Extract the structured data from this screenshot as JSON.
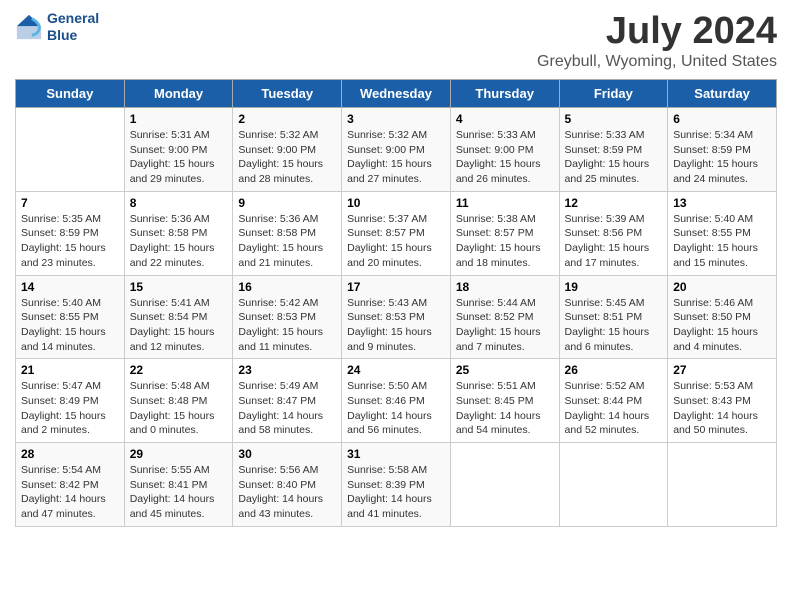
{
  "header": {
    "logo_line1": "General",
    "logo_line2": "Blue",
    "title": "July 2024",
    "subtitle": "Greybull, Wyoming, United States"
  },
  "days_of_week": [
    "Sunday",
    "Monday",
    "Tuesday",
    "Wednesday",
    "Thursday",
    "Friday",
    "Saturday"
  ],
  "weeks": [
    [
      {
        "num": "",
        "sunrise": "",
        "sunset": "",
        "daylight": ""
      },
      {
        "num": "1",
        "sunrise": "Sunrise: 5:31 AM",
        "sunset": "Sunset: 9:00 PM",
        "daylight": "Daylight: 15 hours and 29 minutes."
      },
      {
        "num": "2",
        "sunrise": "Sunrise: 5:32 AM",
        "sunset": "Sunset: 9:00 PM",
        "daylight": "Daylight: 15 hours and 28 minutes."
      },
      {
        "num": "3",
        "sunrise": "Sunrise: 5:32 AM",
        "sunset": "Sunset: 9:00 PM",
        "daylight": "Daylight: 15 hours and 27 minutes."
      },
      {
        "num": "4",
        "sunrise": "Sunrise: 5:33 AM",
        "sunset": "Sunset: 9:00 PM",
        "daylight": "Daylight: 15 hours and 26 minutes."
      },
      {
        "num": "5",
        "sunrise": "Sunrise: 5:33 AM",
        "sunset": "Sunset: 8:59 PM",
        "daylight": "Daylight: 15 hours and 25 minutes."
      },
      {
        "num": "6",
        "sunrise": "Sunrise: 5:34 AM",
        "sunset": "Sunset: 8:59 PM",
        "daylight": "Daylight: 15 hours and 24 minutes."
      }
    ],
    [
      {
        "num": "7",
        "sunrise": "Sunrise: 5:35 AM",
        "sunset": "Sunset: 8:59 PM",
        "daylight": "Daylight: 15 hours and 23 minutes."
      },
      {
        "num": "8",
        "sunrise": "Sunrise: 5:36 AM",
        "sunset": "Sunset: 8:58 PM",
        "daylight": "Daylight: 15 hours and 22 minutes."
      },
      {
        "num": "9",
        "sunrise": "Sunrise: 5:36 AM",
        "sunset": "Sunset: 8:58 PM",
        "daylight": "Daylight: 15 hours and 21 minutes."
      },
      {
        "num": "10",
        "sunrise": "Sunrise: 5:37 AM",
        "sunset": "Sunset: 8:57 PM",
        "daylight": "Daylight: 15 hours and 20 minutes."
      },
      {
        "num": "11",
        "sunrise": "Sunrise: 5:38 AM",
        "sunset": "Sunset: 8:57 PM",
        "daylight": "Daylight: 15 hours and 18 minutes."
      },
      {
        "num": "12",
        "sunrise": "Sunrise: 5:39 AM",
        "sunset": "Sunset: 8:56 PM",
        "daylight": "Daylight: 15 hours and 17 minutes."
      },
      {
        "num": "13",
        "sunrise": "Sunrise: 5:40 AM",
        "sunset": "Sunset: 8:55 PM",
        "daylight": "Daylight: 15 hours and 15 minutes."
      }
    ],
    [
      {
        "num": "14",
        "sunrise": "Sunrise: 5:40 AM",
        "sunset": "Sunset: 8:55 PM",
        "daylight": "Daylight: 15 hours and 14 minutes."
      },
      {
        "num": "15",
        "sunrise": "Sunrise: 5:41 AM",
        "sunset": "Sunset: 8:54 PM",
        "daylight": "Daylight: 15 hours and 12 minutes."
      },
      {
        "num": "16",
        "sunrise": "Sunrise: 5:42 AM",
        "sunset": "Sunset: 8:53 PM",
        "daylight": "Daylight: 15 hours and 11 minutes."
      },
      {
        "num": "17",
        "sunrise": "Sunrise: 5:43 AM",
        "sunset": "Sunset: 8:53 PM",
        "daylight": "Daylight: 15 hours and 9 minutes."
      },
      {
        "num": "18",
        "sunrise": "Sunrise: 5:44 AM",
        "sunset": "Sunset: 8:52 PM",
        "daylight": "Daylight: 15 hours and 7 minutes."
      },
      {
        "num": "19",
        "sunrise": "Sunrise: 5:45 AM",
        "sunset": "Sunset: 8:51 PM",
        "daylight": "Daylight: 15 hours and 6 minutes."
      },
      {
        "num": "20",
        "sunrise": "Sunrise: 5:46 AM",
        "sunset": "Sunset: 8:50 PM",
        "daylight": "Daylight: 15 hours and 4 minutes."
      }
    ],
    [
      {
        "num": "21",
        "sunrise": "Sunrise: 5:47 AM",
        "sunset": "Sunset: 8:49 PM",
        "daylight": "Daylight: 15 hours and 2 minutes."
      },
      {
        "num": "22",
        "sunrise": "Sunrise: 5:48 AM",
        "sunset": "Sunset: 8:48 PM",
        "daylight": "Daylight: 15 hours and 0 minutes."
      },
      {
        "num": "23",
        "sunrise": "Sunrise: 5:49 AM",
        "sunset": "Sunset: 8:47 PM",
        "daylight": "Daylight: 14 hours and 58 minutes."
      },
      {
        "num": "24",
        "sunrise": "Sunrise: 5:50 AM",
        "sunset": "Sunset: 8:46 PM",
        "daylight": "Daylight: 14 hours and 56 minutes."
      },
      {
        "num": "25",
        "sunrise": "Sunrise: 5:51 AM",
        "sunset": "Sunset: 8:45 PM",
        "daylight": "Daylight: 14 hours and 54 minutes."
      },
      {
        "num": "26",
        "sunrise": "Sunrise: 5:52 AM",
        "sunset": "Sunset: 8:44 PM",
        "daylight": "Daylight: 14 hours and 52 minutes."
      },
      {
        "num": "27",
        "sunrise": "Sunrise: 5:53 AM",
        "sunset": "Sunset: 8:43 PM",
        "daylight": "Daylight: 14 hours and 50 minutes."
      }
    ],
    [
      {
        "num": "28",
        "sunrise": "Sunrise: 5:54 AM",
        "sunset": "Sunset: 8:42 PM",
        "daylight": "Daylight: 14 hours and 47 minutes."
      },
      {
        "num": "29",
        "sunrise": "Sunrise: 5:55 AM",
        "sunset": "Sunset: 8:41 PM",
        "daylight": "Daylight: 14 hours and 45 minutes."
      },
      {
        "num": "30",
        "sunrise": "Sunrise: 5:56 AM",
        "sunset": "Sunset: 8:40 PM",
        "daylight": "Daylight: 14 hours and 43 minutes."
      },
      {
        "num": "31",
        "sunrise": "Sunrise: 5:58 AM",
        "sunset": "Sunset: 8:39 PM",
        "daylight": "Daylight: 14 hours and 41 minutes."
      },
      {
        "num": "",
        "sunrise": "",
        "sunset": "",
        "daylight": ""
      },
      {
        "num": "",
        "sunrise": "",
        "sunset": "",
        "daylight": ""
      },
      {
        "num": "",
        "sunrise": "",
        "sunset": "",
        "daylight": ""
      }
    ]
  ]
}
